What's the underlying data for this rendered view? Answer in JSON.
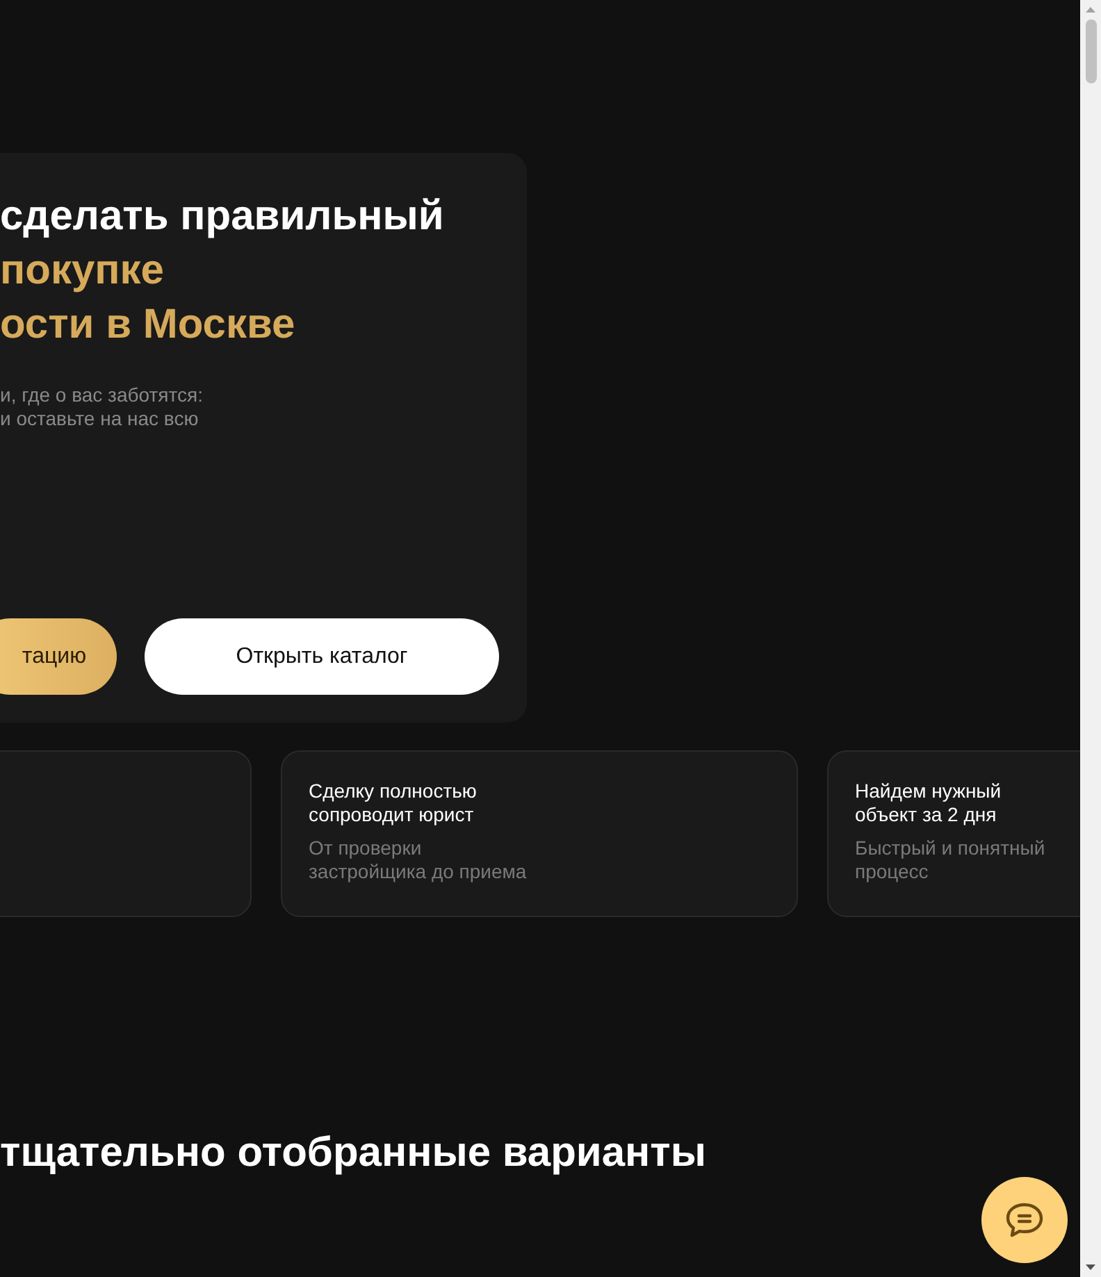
{
  "hero": {
    "title_lines": [
      {
        "text": "сделать правильный",
        "accent": false
      },
      {
        "text": "покупке",
        "accent": true
      },
      {
        "text": "ости в Москве",
        "accent": true
      }
    ],
    "subtitle_lines": [
      "и, где о вас заботятся:",
      "и оставьте на нас всю"
    ],
    "buttons": [
      {
        "label": "тацию",
        "kind": "primary"
      },
      {
        "label": "Открыть каталог",
        "kind": "secondary"
      }
    ]
  },
  "features": [
    {
      "kind": "blank"
    },
    {
      "kind": "text",
      "title": "Сделку полностью\nсопроводит юрист",
      "description": "От проверки\nзастройщика до приема"
    },
    {
      "kind": "text",
      "title": "Найдем нужный\nобъект за 2 дня",
      "description": "Быстрый и понятный\nпроцесс"
    }
  ],
  "section_title": "тщательно отобранные варианты"
}
